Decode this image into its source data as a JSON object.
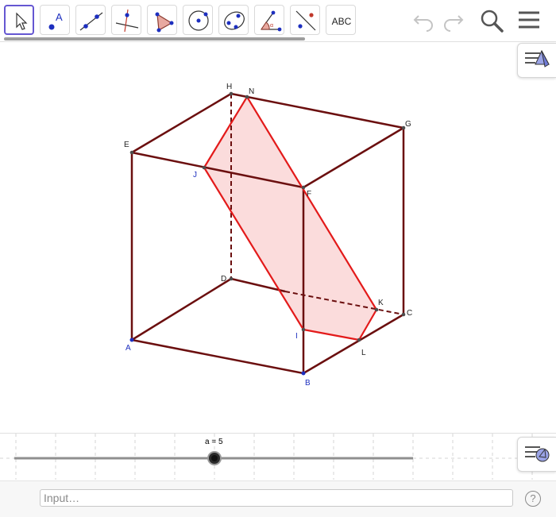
{
  "toolbar": {
    "tools": [
      {
        "name": "move-tool",
        "icon": "cursor-arrow-icon",
        "selected": true
      },
      {
        "name": "point-tool",
        "icon": "point-a-icon",
        "label": "A"
      },
      {
        "name": "line-tool",
        "icon": "line-through-points-icon"
      },
      {
        "name": "perpendicular-line-tool",
        "icon": "perpendicular-line-icon"
      },
      {
        "name": "polygon-tool",
        "icon": "polygon-icon"
      },
      {
        "name": "circle-center-point-tool",
        "icon": "circle-center-icon"
      },
      {
        "name": "conic-tool",
        "icon": "conic-ellipse-icon"
      },
      {
        "name": "angle-tool",
        "icon": "angle-icon"
      },
      {
        "name": "reflect-tool",
        "icon": "reflect-about-line-icon"
      },
      {
        "name": "text-tool",
        "icon": "text-icon",
        "label": "ABC"
      }
    ],
    "undo_icon": "undo-icon",
    "redo_icon": "redo-icon",
    "search_icon": "search-icon",
    "menu_icon": "menu-icon"
  },
  "colors": {
    "edge": "#6b0f0f",
    "section": "#e31a1a",
    "section_fill": "#fbdcdc",
    "vertex": "#4d4d4d",
    "label_blue": "#1d2fbf",
    "selected_tool": "#6557d2"
  },
  "graphics": {
    "vertex_labels": {
      "A": "A",
      "B": "B",
      "C": "C",
      "D": "D",
      "E": "E",
      "F": "F",
      "G": "G",
      "H": "H",
      "I": "I",
      "J": "J",
      "K": "K",
      "L": "L",
      "N": "N"
    }
  },
  "slider": {
    "label": "a = 5",
    "value": 5
  },
  "input_bar": {
    "placeholder": "Input…",
    "help_label": "?"
  }
}
